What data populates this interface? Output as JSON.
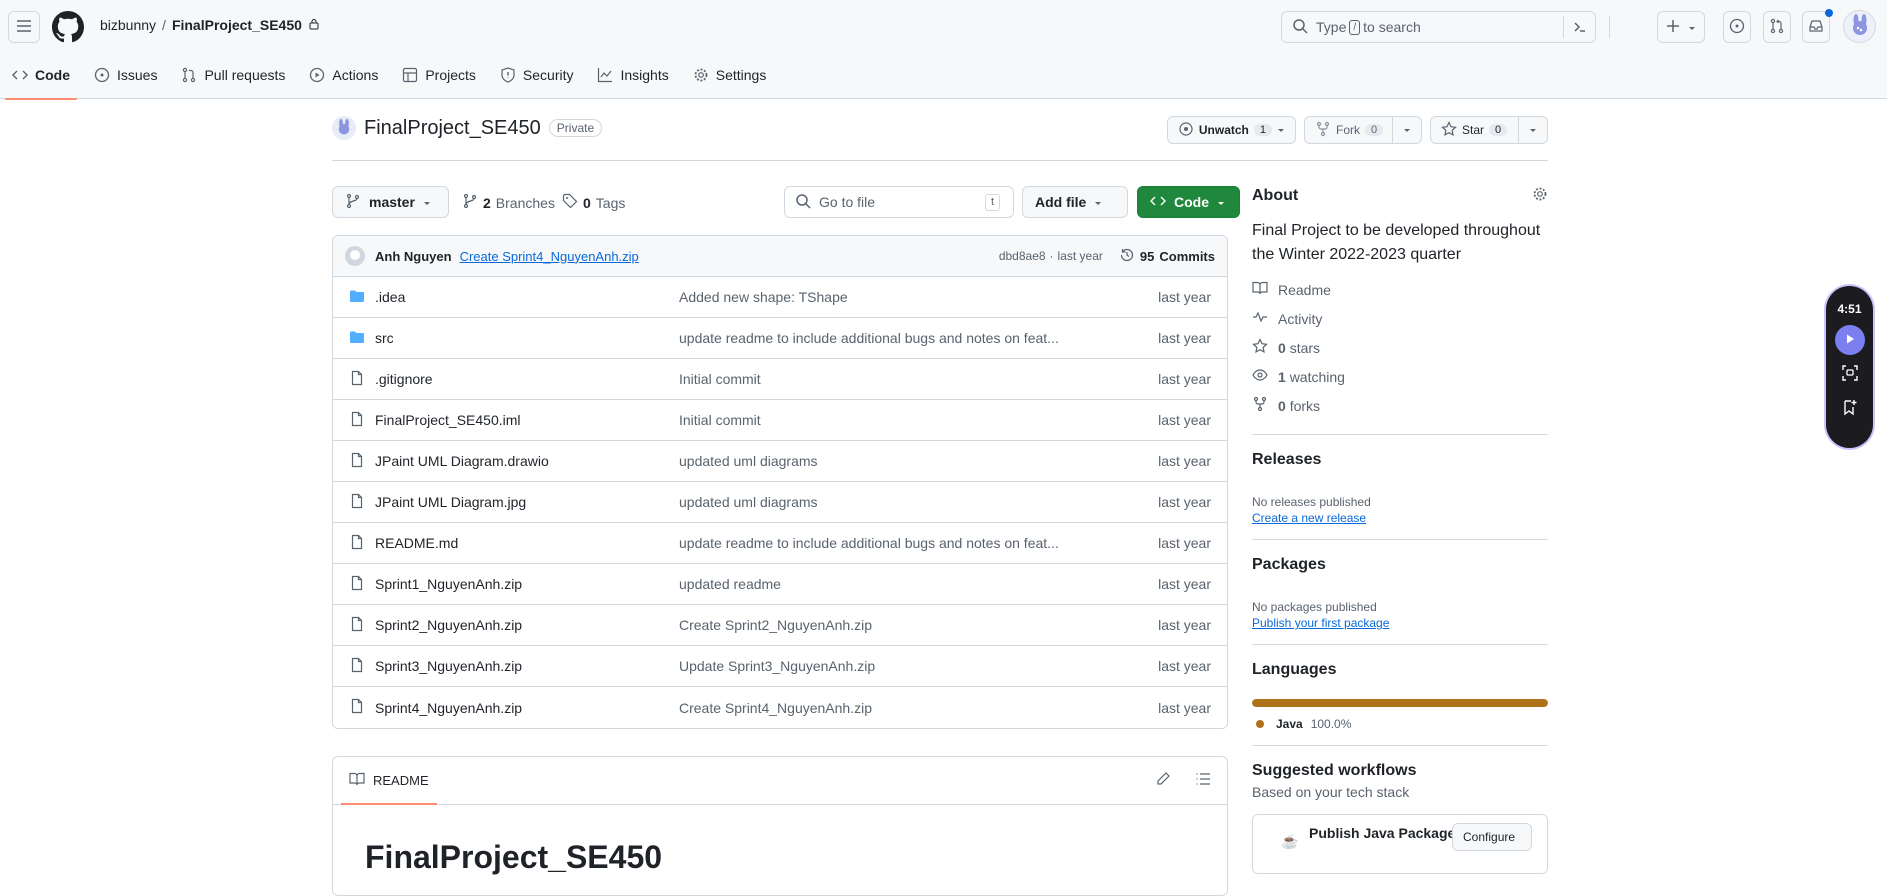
{
  "header": {
    "owner": "bizbunny",
    "separator": "/",
    "repo": "FinalProject_SE450",
    "search_prefix": "Type",
    "search_key": "/",
    "search_suffix": "to search"
  },
  "tabs": [
    {
      "label": "Code",
      "icon": "code-icon",
      "active": true
    },
    {
      "label": "Issues",
      "icon": "issue-icon"
    },
    {
      "label": "Pull requests",
      "icon": "pull-request-icon"
    },
    {
      "label": "Actions",
      "icon": "play-icon"
    },
    {
      "label": "Projects",
      "icon": "table-icon"
    },
    {
      "label": "Security",
      "icon": "shield-icon"
    },
    {
      "label": "Insights",
      "icon": "graph-icon"
    },
    {
      "label": "Settings",
      "icon": "gear-icon"
    }
  ],
  "repo": {
    "title": "FinalProject_SE450",
    "visibility": "Private",
    "watch_label": "Unwatch",
    "watch_count": "1",
    "fork_label": "Fork",
    "fork_count": "0",
    "star_label": "Star",
    "star_count": "0"
  },
  "toolbar": {
    "branch": "master",
    "branches_count": "2",
    "branches_label": "Branches",
    "tags_count": "0",
    "tags_label": "Tags",
    "goto_placeholder": "Go to file",
    "goto_key": "t",
    "add_file": "Add file",
    "code": "Code"
  },
  "commit": {
    "author": "Anh Nguyen",
    "message": "Create Sprint4_NguyenAnh.zip",
    "hash": "dbd8ae8",
    "age": "last year",
    "commits_count": "95",
    "commits_label": "Commits"
  },
  "files": [
    {
      "name": ".idea",
      "type": "folder",
      "message": "Added new shape: TShape",
      "age": "last year"
    },
    {
      "name": "src",
      "type": "folder",
      "message": "update readme to include additional bugs and notes on feat...",
      "age": "last year"
    },
    {
      "name": ".gitignore",
      "type": "file",
      "message": "Initial commit",
      "age": "last year"
    },
    {
      "name": "FinalProject_SE450.iml",
      "type": "file",
      "message": "Initial commit",
      "age": "last year"
    },
    {
      "name": "JPaint UML Diagram.drawio",
      "type": "file",
      "message": "updated uml diagrams",
      "age": "last year"
    },
    {
      "name": "JPaint UML Diagram.jpg",
      "type": "file",
      "message": "updated uml diagrams",
      "age": "last year"
    },
    {
      "name": "README.md",
      "type": "file",
      "message": "update readme to include additional bugs and notes on feat...",
      "age": "last year"
    },
    {
      "name": "Sprint1_NguyenAnh.zip",
      "type": "file",
      "message": "updated readme",
      "age": "last year"
    },
    {
      "name": "Sprint2_NguyenAnh.zip",
      "type": "file",
      "message": "Create Sprint2_NguyenAnh.zip",
      "age": "last year"
    },
    {
      "name": "Sprint3_NguyenAnh.zip",
      "type": "file",
      "message": "Update Sprint3_NguyenAnh.zip",
      "age": "last year"
    },
    {
      "name": "Sprint4_NguyenAnh.zip",
      "type": "file",
      "message": "Create Sprint4_NguyenAnh.zip",
      "age": "last year"
    }
  ],
  "readme": {
    "tab_label": "README",
    "heading": "FinalProject_SE450"
  },
  "about": {
    "title": "About",
    "description": "Final Project to be developed throughout the Winter 2022-2023 quarter",
    "readme": "Readme",
    "activity": "Activity",
    "stars_count": "0",
    "stars_label": "stars",
    "watching_count": "1",
    "watching_label": "watching",
    "forks_count": "0",
    "forks_label": "forks"
  },
  "releases": {
    "title": "Releases",
    "empty": "No releases published",
    "link": "Create a new release"
  },
  "packages": {
    "title": "Packages",
    "empty": "No packages published",
    "link": "Publish your first package"
  },
  "languages": {
    "title": "Languages",
    "items": [
      {
        "name": "Java",
        "percent": "100.0%",
        "fraction": 1.0,
        "color": "#b07219"
      }
    ]
  },
  "workflows": {
    "title": "Suggested workflows",
    "subtitle": "Based on your tech stack",
    "item": "Publish Java Package",
    "configure": "Configure"
  },
  "recorder": {
    "time": "4:51"
  },
  "colors": {
    "accent_tab": "#fd8c73",
    "green_button": "#1f883d",
    "link": "#0969da",
    "folder": "#54aeff",
    "recorder_play": "#7c7ff0"
  }
}
